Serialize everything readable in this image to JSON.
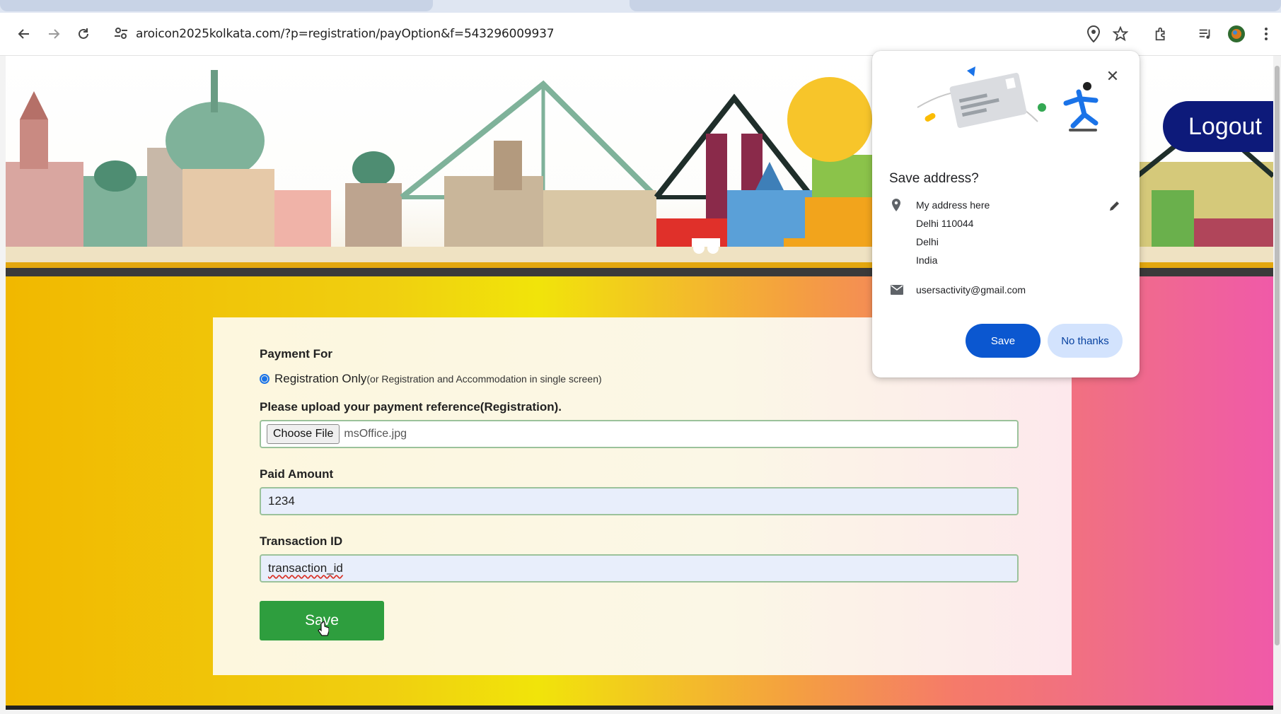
{
  "browser": {
    "url": "aroicon2025kolkata.com/?p=registration/payOption&f=543296009937"
  },
  "header": {
    "logout_label": "Logout"
  },
  "form": {
    "payment_for_label": "Payment For",
    "radio_label": "Registration Only",
    "radio_note": "(or Registration and Accommodation in single screen)",
    "upload_label": "Please upload your payment reference(Registration).",
    "choose_file_label": "Choose File",
    "file_name": "msOffice.jpg",
    "paid_amount_label": "Paid Amount",
    "paid_amount_value": "1234",
    "transaction_label": "Transaction ID",
    "transaction_value": "transaction_id",
    "save_label": "Save"
  },
  "popup": {
    "title": "Save address?",
    "address_lines": [
      "My address here",
      "Delhi 110044",
      "Delhi",
      "India"
    ],
    "email": "usersactivity@gmail.com",
    "save_label": "Save",
    "no_thanks_label": "No thanks"
  },
  "colors": {
    "save_green": "#2e9e3e",
    "logout_navy": "#0d1a7a",
    "chrome_blue": "#0b57d0"
  }
}
